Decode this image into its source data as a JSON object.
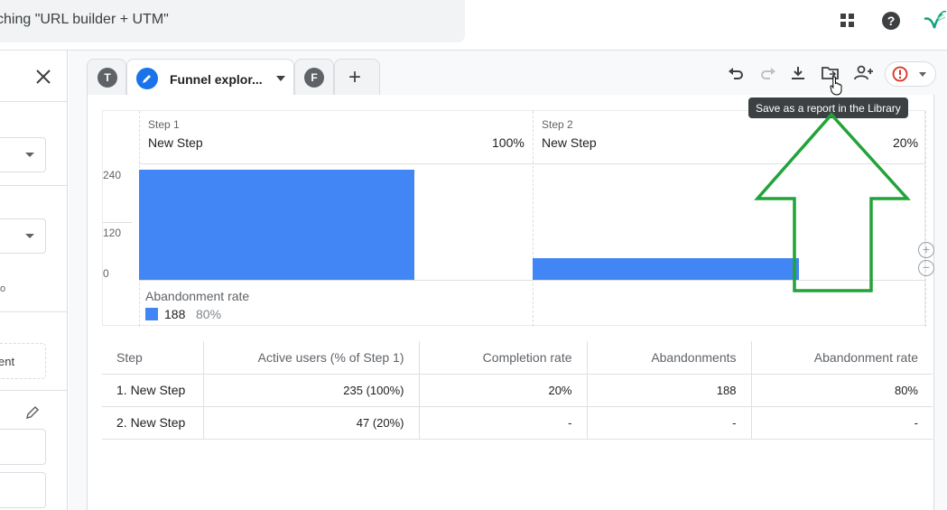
{
  "topbar": {
    "search_text": "ching \"URL builder + UTM\"",
    "icons": [
      "apps-grid-icon",
      "help-icon",
      "hummingbird-logo-icon"
    ]
  },
  "left_panel": {
    "close_icon": "close-icon",
    "dashed_button_label": "ent",
    "tiny_text": "o",
    "pencil_icon": "edit-pencil-icon"
  },
  "tabs": {
    "tab1_letter": "T",
    "active_label": "Funnel explor...",
    "tab3_letter": "F",
    "add_symbol": "+"
  },
  "toolbar": {
    "icons": [
      "undo-icon",
      "redo-icon",
      "download-icon",
      "save-to-library-icon",
      "share-users-icon",
      "alert-icon"
    ],
    "tooltip": "Save as a report in the Library"
  },
  "funnel": {
    "steps": [
      {
        "small": "Step 1",
        "name": "New Step",
        "pct": "100%"
      },
      {
        "small": "Step 2",
        "name": "New Step",
        "pct": "20%"
      }
    ],
    "y_ticks": [
      "240",
      "120",
      "0"
    ],
    "abandonment": {
      "label": "Abandonment rate",
      "value": "188",
      "pct": "80%"
    },
    "colors": {
      "bar": "#4285f4"
    }
  },
  "chart_data": {
    "type": "bar",
    "categories": [
      "Step 1",
      "Step 2"
    ],
    "values": [
      235,
      47
    ],
    "ylim": [
      0,
      240
    ]
  },
  "table": {
    "headers": [
      "Step",
      "Active users (% of Step 1)",
      "Completion rate",
      "Abandonments",
      "Abandonment rate"
    ],
    "rows": [
      [
        "1. New Step",
        "235 (100%)",
        "20%",
        "188",
        "80%"
      ],
      [
        "2. New Step",
        "47 (20%)",
        "-",
        "-",
        "-"
      ]
    ]
  },
  "annotation": {
    "color": "#22a33a"
  }
}
